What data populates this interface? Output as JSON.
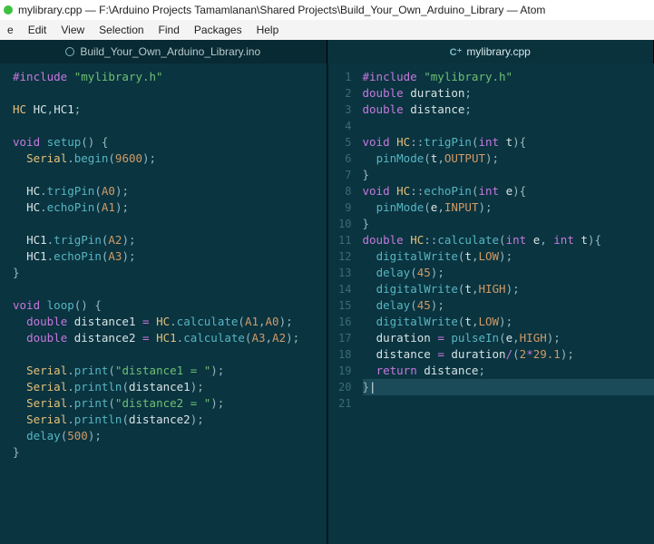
{
  "window": {
    "title": "mylibrary.cpp — F:\\Arduino Projects Tamamlanan\\Shared Projects\\Build_Your_Own_Arduino_Library — Atom"
  },
  "menu": {
    "items": [
      "e",
      "Edit",
      "View",
      "Selection",
      "Find",
      "Packages",
      "Help"
    ]
  },
  "tabs": {
    "left": {
      "icon": "ino-icon",
      "label": "Build_Your_Own_Arduino_Library.ino"
    },
    "right": {
      "icon": "cpp-icon",
      "glyph": "C⁺",
      "label": "mylibrary.cpp"
    }
  },
  "left_code": [
    [
      [
        "pp",
        "#include"
      ],
      [
        "pn",
        " "
      ],
      [
        "str",
        "\"mylibrary.h\""
      ]
    ],
    [],
    [
      [
        "ty",
        "HC"
      ],
      [
        "pn",
        " "
      ],
      [
        "id",
        "HC"
      ],
      [
        "pn",
        ","
      ],
      [
        "id",
        "HC1"
      ],
      [
        "pn",
        ";"
      ]
    ],
    [],
    [
      [
        "kw",
        "void"
      ],
      [
        "pn",
        " "
      ],
      [
        "fn",
        "setup"
      ],
      [
        "pn",
        "() {"
      ]
    ],
    [
      [
        "pn",
        "  "
      ],
      [
        "ty",
        "Serial"
      ],
      [
        "pn",
        "."
      ],
      [
        "fn",
        "begin"
      ],
      [
        "pn",
        "("
      ],
      [
        "num",
        "9600"
      ],
      [
        "pn",
        ");"
      ]
    ],
    [],
    [
      [
        "pn",
        "  "
      ],
      [
        "id",
        "HC"
      ],
      [
        "pn",
        "."
      ],
      [
        "fn",
        "trigPin"
      ],
      [
        "pn",
        "("
      ],
      [
        "num",
        "A0"
      ],
      [
        "pn",
        ");"
      ]
    ],
    [
      [
        "pn",
        "  "
      ],
      [
        "id",
        "HC"
      ],
      [
        "pn",
        "."
      ],
      [
        "fn",
        "echoPin"
      ],
      [
        "pn",
        "("
      ],
      [
        "num",
        "A1"
      ],
      [
        "pn",
        ");"
      ]
    ],
    [],
    [
      [
        "pn",
        "  "
      ],
      [
        "id",
        "HC1"
      ],
      [
        "pn",
        "."
      ],
      [
        "fn",
        "trigPin"
      ],
      [
        "pn",
        "("
      ],
      [
        "num",
        "A2"
      ],
      [
        "pn",
        ");"
      ]
    ],
    [
      [
        "pn",
        "  "
      ],
      [
        "id",
        "HC1"
      ],
      [
        "pn",
        "."
      ],
      [
        "fn",
        "echoPin"
      ],
      [
        "pn",
        "("
      ],
      [
        "num",
        "A3"
      ],
      [
        "pn",
        ");"
      ]
    ],
    [
      [
        "pn",
        "}"
      ]
    ],
    [],
    [
      [
        "kw",
        "void"
      ],
      [
        "pn",
        " "
      ],
      [
        "fn",
        "loop"
      ],
      [
        "pn",
        "() {"
      ]
    ],
    [
      [
        "pn",
        "  "
      ],
      [
        "kw",
        "double"
      ],
      [
        "pn",
        " "
      ],
      [
        "id",
        "distance1"
      ],
      [
        "pn",
        " "
      ],
      [
        "op",
        "="
      ],
      [
        "pn",
        " "
      ],
      [
        "ty",
        "HC"
      ],
      [
        "pn",
        "."
      ],
      [
        "fn",
        "calculate"
      ],
      [
        "pn",
        "("
      ],
      [
        "num",
        "A1"
      ],
      [
        "pn",
        ","
      ],
      [
        "num",
        "A0"
      ],
      [
        "pn",
        ");"
      ]
    ],
    [
      [
        "pn",
        "  "
      ],
      [
        "kw",
        "double"
      ],
      [
        "pn",
        " "
      ],
      [
        "id",
        "distance2"
      ],
      [
        "pn",
        " "
      ],
      [
        "op",
        "="
      ],
      [
        "pn",
        " "
      ],
      [
        "ty",
        "HC1"
      ],
      [
        "pn",
        "."
      ],
      [
        "fn",
        "calculate"
      ],
      [
        "pn",
        "("
      ],
      [
        "num",
        "A3"
      ],
      [
        "pn",
        ","
      ],
      [
        "num",
        "A2"
      ],
      [
        "pn",
        ");"
      ]
    ],
    [],
    [
      [
        "pn",
        "  "
      ],
      [
        "ty",
        "Serial"
      ],
      [
        "pn",
        "."
      ],
      [
        "fn",
        "print"
      ],
      [
        "pn",
        "("
      ],
      [
        "str",
        "\"distance1 = \""
      ],
      [
        "pn",
        ");"
      ]
    ],
    [
      [
        "pn",
        "  "
      ],
      [
        "ty",
        "Serial"
      ],
      [
        "pn",
        "."
      ],
      [
        "fn",
        "println"
      ],
      [
        "pn",
        "("
      ],
      [
        "id",
        "distance1"
      ],
      [
        "pn",
        ");"
      ]
    ],
    [
      [
        "pn",
        "  "
      ],
      [
        "ty",
        "Serial"
      ],
      [
        "pn",
        "."
      ],
      [
        "fn",
        "print"
      ],
      [
        "pn",
        "("
      ],
      [
        "str",
        "\"distance2 = \""
      ],
      [
        "pn",
        ");"
      ]
    ],
    [
      [
        "pn",
        "  "
      ],
      [
        "ty",
        "Serial"
      ],
      [
        "pn",
        "."
      ],
      [
        "fn",
        "println"
      ],
      [
        "pn",
        "("
      ],
      [
        "id",
        "distance2"
      ],
      [
        "pn",
        ");"
      ]
    ],
    [
      [
        "pn",
        "  "
      ],
      [
        "fn",
        "delay"
      ],
      [
        "pn",
        "("
      ],
      [
        "num",
        "500"
      ],
      [
        "pn",
        ");"
      ]
    ],
    [
      [
        "pn",
        "}"
      ]
    ]
  ],
  "right_lines": [
    "1",
    "2",
    "3",
    "4",
    "5",
    "6",
    "7",
    "8",
    "9",
    "10",
    "11",
    "12",
    "13",
    "14",
    "15",
    "16",
    "17",
    "18",
    "19",
    "20",
    "21"
  ],
  "right_code": [
    [
      [
        "pp",
        "#include"
      ],
      [
        "pn",
        " "
      ],
      [
        "str",
        "\"mylibrary.h\""
      ]
    ],
    [
      [
        "kw",
        "double"
      ],
      [
        "pn",
        " "
      ],
      [
        "id",
        "duration"
      ],
      [
        "pn",
        ";"
      ]
    ],
    [
      [
        "kw",
        "double"
      ],
      [
        "pn",
        " "
      ],
      [
        "id",
        "distance"
      ],
      [
        "pn",
        ";"
      ]
    ],
    [],
    [
      [
        "kw",
        "void"
      ],
      [
        "pn",
        " "
      ],
      [
        "ty",
        "HC"
      ],
      [
        "pn",
        "::"
      ],
      [
        "fn",
        "trigPin"
      ],
      [
        "pn",
        "("
      ],
      [
        "kw",
        "int"
      ],
      [
        "pn",
        " "
      ],
      [
        "id",
        "t"
      ],
      [
        "pn",
        "){"
      ]
    ],
    [
      [
        "pn",
        "  "
      ],
      [
        "fn",
        "pinMode"
      ],
      [
        "pn",
        "("
      ],
      [
        "id",
        "t"
      ],
      [
        "pn",
        ","
      ],
      [
        "num",
        "OUTPUT"
      ],
      [
        "pn",
        ");"
      ]
    ],
    [
      [
        "pn",
        "}"
      ]
    ],
    [
      [
        "kw",
        "void"
      ],
      [
        "pn",
        " "
      ],
      [
        "ty",
        "HC"
      ],
      [
        "pn",
        "::"
      ],
      [
        "fn",
        "echoPin"
      ],
      [
        "pn",
        "("
      ],
      [
        "kw",
        "int"
      ],
      [
        "pn",
        " "
      ],
      [
        "id",
        "e"
      ],
      [
        "pn",
        "){"
      ]
    ],
    [
      [
        "pn",
        "  "
      ],
      [
        "fn",
        "pinMode"
      ],
      [
        "pn",
        "("
      ],
      [
        "id",
        "e"
      ],
      [
        "pn",
        ","
      ],
      [
        "num",
        "INPUT"
      ],
      [
        "pn",
        ");"
      ]
    ],
    [
      [
        "pn",
        "}"
      ]
    ],
    [
      [
        "kw",
        "double"
      ],
      [
        "pn",
        " "
      ],
      [
        "ty",
        "HC"
      ],
      [
        "pn",
        "::"
      ],
      [
        "fn",
        "calculate"
      ],
      [
        "pn",
        "("
      ],
      [
        "kw",
        "int"
      ],
      [
        "pn",
        " "
      ],
      [
        "id",
        "e"
      ],
      [
        "pn",
        ", "
      ],
      [
        "kw",
        "int"
      ],
      [
        "pn",
        " "
      ],
      [
        "id",
        "t"
      ],
      [
        "pn",
        "){"
      ]
    ],
    [
      [
        "pn",
        "  "
      ],
      [
        "fn",
        "digitalWrite"
      ],
      [
        "pn",
        "("
      ],
      [
        "id",
        "t"
      ],
      [
        "pn",
        ","
      ],
      [
        "num",
        "LOW"
      ],
      [
        "pn",
        ");"
      ]
    ],
    [
      [
        "pn",
        "  "
      ],
      [
        "fn",
        "delay"
      ],
      [
        "pn",
        "("
      ],
      [
        "num",
        "45"
      ],
      [
        "pn",
        ");"
      ]
    ],
    [
      [
        "pn",
        "  "
      ],
      [
        "fn",
        "digitalWrite"
      ],
      [
        "pn",
        "("
      ],
      [
        "id",
        "t"
      ],
      [
        "pn",
        ","
      ],
      [
        "num",
        "HIGH"
      ],
      [
        "pn",
        ");"
      ]
    ],
    [
      [
        "pn",
        "  "
      ],
      [
        "fn",
        "delay"
      ],
      [
        "pn",
        "("
      ],
      [
        "num",
        "45"
      ],
      [
        "pn",
        ");"
      ]
    ],
    [
      [
        "pn",
        "  "
      ],
      [
        "fn",
        "digitalWrite"
      ],
      [
        "pn",
        "("
      ],
      [
        "id",
        "t"
      ],
      [
        "pn",
        ","
      ],
      [
        "num",
        "LOW"
      ],
      [
        "pn",
        ");"
      ]
    ],
    [
      [
        "pn",
        "  "
      ],
      [
        "id",
        "duration"
      ],
      [
        "pn",
        " "
      ],
      [
        "op",
        "="
      ],
      [
        "pn",
        " "
      ],
      [
        "fn",
        "pulseIn"
      ],
      [
        "pn",
        "("
      ],
      [
        "id",
        "e"
      ],
      [
        "pn",
        ","
      ],
      [
        "num",
        "HIGH"
      ],
      [
        "pn",
        ");"
      ]
    ],
    [
      [
        "pn",
        "  "
      ],
      [
        "id",
        "distance"
      ],
      [
        "pn",
        " "
      ],
      [
        "op",
        "="
      ],
      [
        "pn",
        " "
      ],
      [
        "id",
        "duration"
      ],
      [
        "op",
        "/"
      ],
      [
        "pn",
        "("
      ],
      [
        "num",
        "2"
      ],
      [
        "op",
        "*"
      ],
      [
        "num",
        "29.1"
      ],
      [
        "pn",
        ");"
      ]
    ],
    [
      [
        "pn",
        "  "
      ],
      [
        "kw",
        "return"
      ],
      [
        "pn",
        " "
      ],
      [
        "id",
        "distance"
      ],
      [
        "pn",
        ";"
      ]
    ],
    [
      [
        "pn",
        "}"
      ],
      [
        "id",
        "|"
      ]
    ],
    []
  ],
  "highlight_right_index": 19
}
